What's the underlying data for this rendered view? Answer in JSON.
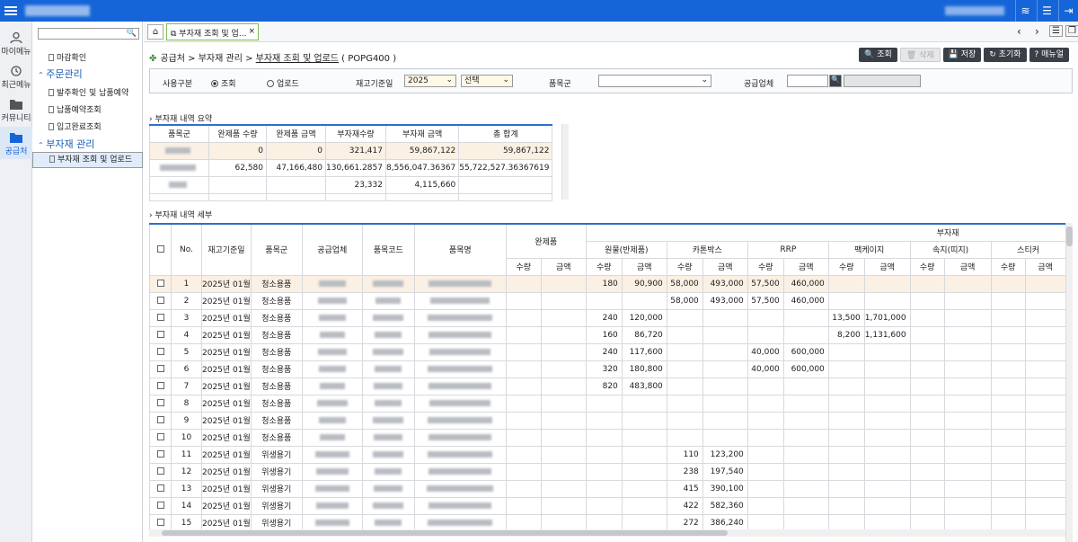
{
  "leftnav": [
    {
      "label": "마이메뉴",
      "icon": "person-icon"
    },
    {
      "label": "최근메뉴",
      "icon": "history-icon"
    },
    {
      "label": "커뮤니티",
      "icon": "folder-icon"
    },
    {
      "label": "공급처",
      "icon": "folder-icon"
    }
  ],
  "sidebar": {
    "items": [
      "마감확인",
      "주문관리",
      "발주확인 및 납품예약",
      "납품예약조회",
      "입고완료조회",
      "부자재 관리",
      "부자재 조회 및 업로드"
    ]
  },
  "tab": {
    "label": "부자재 조회 및 업...",
    "close": "×"
  },
  "breadcrumb": {
    "path": "공급처 > 부자재 관리 > ",
    "current": "부자재 조회 및 업로드",
    "code": " ( POPG400 )"
  },
  "buttons": {
    "search": "조회",
    "delete": "삭제",
    "save": "저장",
    "reset": "초기화",
    "manual": "매뉴얼"
  },
  "filter": {
    "usage_label": "사용구분",
    "opt_search": "조회",
    "opt_upload": "업로드",
    "stock_label": "재고기준일",
    "year": "2025",
    "month": "선택",
    "category_label": "품목군",
    "supplier_label": "공급업체"
  },
  "summary": {
    "title": "부자재 내역 요약",
    "headers": [
      "품목군",
      "완제품 수량",
      "완제품 금액",
      "부자재수량",
      "부자재 금액",
      "총 합계"
    ],
    "rows": [
      [
        "",
        "0",
        "0",
        "321,417",
        "59,867,122",
        "59,867,122"
      ],
      [
        "",
        "62,580",
        "47,166,480",
        "130,661.2857",
        "8,556,047.36367",
        "55,722,527.36367619"
      ],
      [
        "",
        "",
        "",
        "23,332",
        "4,115,660",
        ""
      ],
      [
        "",
        "",
        "",
        "",
        "",
        ""
      ]
    ]
  },
  "detail": {
    "title": "부자재 내역 세부",
    "headers": {
      "no": "No.",
      "date": "재고기준일",
      "category": "품목군",
      "supplier": "공급업체",
      "code": "품목코드",
      "name": "품목명",
      "finished": "완제품",
      "subgroup": "부자재",
      "qty": "수량",
      "amount": "금액",
      "groups": [
        "원물(반제품)",
        "카톤박스",
        "RRP",
        "팩케이지",
        "속지(띠지)",
        "스티커"
      ]
    },
    "rows": [
      [
        "1",
        "2025년 01월",
        "청소용품",
        "",
        "",
        "",
        "180",
        "90,900",
        "58,000",
        "493,000",
        "57,500",
        "460,000",
        "",
        ""
      ],
      [
        "2",
        "2025년 01월",
        "청소용품",
        "",
        "",
        "",
        "",
        "",
        "58,000",
        "493,000",
        "57,500",
        "460,000",
        "",
        ""
      ],
      [
        "3",
        "2025년 01월",
        "청소용품",
        "",
        "",
        "",
        "240",
        "120,000",
        "",
        "",
        "",
        "",
        "13,500",
        "1,701,000"
      ],
      [
        "4",
        "2025년 01월",
        "청소용품",
        "",
        "",
        "",
        "160",
        "86,720",
        "",
        "",
        "",
        "",
        "8,200",
        "1,131,600"
      ],
      [
        "5",
        "2025년 01월",
        "청소용품",
        "",
        "",
        "",
        "240",
        "117,600",
        "",
        "",
        "40,000",
        "600,000",
        "",
        ""
      ],
      [
        "6",
        "2025년 01월",
        "청소용품",
        "",
        "",
        "",
        "320",
        "180,800",
        "",
        "",
        "40,000",
        "600,000",
        "",
        ""
      ],
      [
        "7",
        "2025년 01월",
        "청소용품",
        "",
        "",
        "",
        "820",
        "483,800",
        "",
        "",
        "",
        "",
        "",
        ""
      ],
      [
        "8",
        "2025년 01월",
        "청소용품",
        "",
        "",
        "",
        "",
        "",
        "",
        "",
        "",
        "",
        "",
        ""
      ],
      [
        "9",
        "2025년 01월",
        "청소용품",
        "",
        "",
        "",
        "",
        "",
        "",
        "",
        "",
        "",
        "",
        ""
      ],
      [
        "10",
        "2025년 01월",
        "청소용품",
        "",
        "",
        "",
        "",
        "",
        "",
        "",
        "",
        "",
        "",
        ""
      ],
      [
        "11",
        "2025년 01월",
        "위생용기",
        "",
        "",
        "",
        "",
        "",
        "110",
        "123,200",
        "",
        "",
        "",
        ""
      ],
      [
        "12",
        "2025년 01월",
        "위생용기",
        "",
        "",
        "",
        "",
        "",
        "238",
        "197,540",
        "",
        "",
        "",
        ""
      ],
      [
        "13",
        "2025년 01월",
        "위생용기",
        "",
        "",
        "",
        "",
        "",
        "415",
        "390,100",
        "",
        "",
        "",
        ""
      ],
      [
        "14",
        "2025년 01월",
        "위생용기",
        "",
        "",
        "",
        "",
        "",
        "422",
        "582,360",
        "",
        "",
        "",
        ""
      ],
      [
        "15",
        "2025년 01월",
        "위생용기",
        "",
        "",
        "",
        "",
        "",
        "272",
        "386,240",
        "",
        "",
        "",
        ""
      ]
    ]
  }
}
